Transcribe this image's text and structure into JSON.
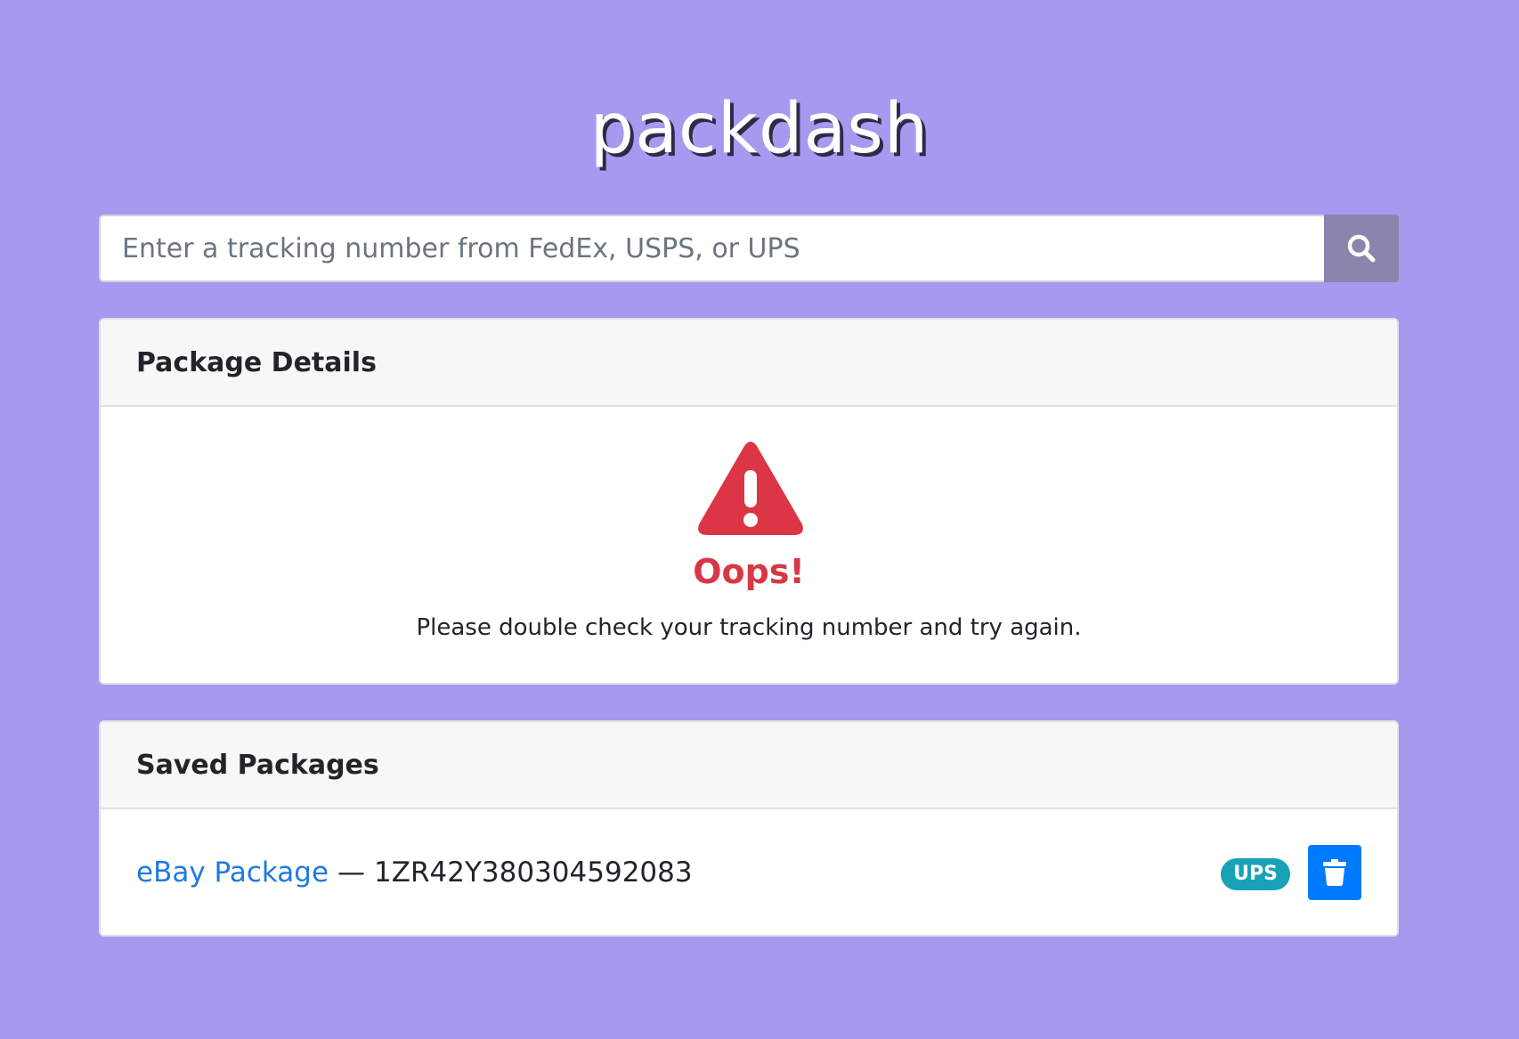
{
  "app": {
    "logo_text": "packdash"
  },
  "search": {
    "placeholder": "Enter a tracking number from FedEx, USPS, or UPS",
    "value": "",
    "button_icon": "search-icon"
  },
  "package_details": {
    "title": "Package Details",
    "error_icon": "warning-triangle-icon",
    "error_title": "Oops!",
    "error_message": "Please double check your tracking number and try again.",
    "error_color": "#dc3545"
  },
  "saved_packages": {
    "title": "Saved Packages",
    "items": [
      {
        "name": "eBay Package",
        "separator": "—",
        "tracking_number": "1ZR42Y380304592083",
        "carrier": "UPS",
        "delete_icon": "trash-icon"
      }
    ]
  },
  "colors": {
    "background": "#a69af0",
    "link": "#1f7ae0",
    "badge": "#17a2b8",
    "delete_button": "#007bff",
    "search_button": "#8a85ad"
  }
}
